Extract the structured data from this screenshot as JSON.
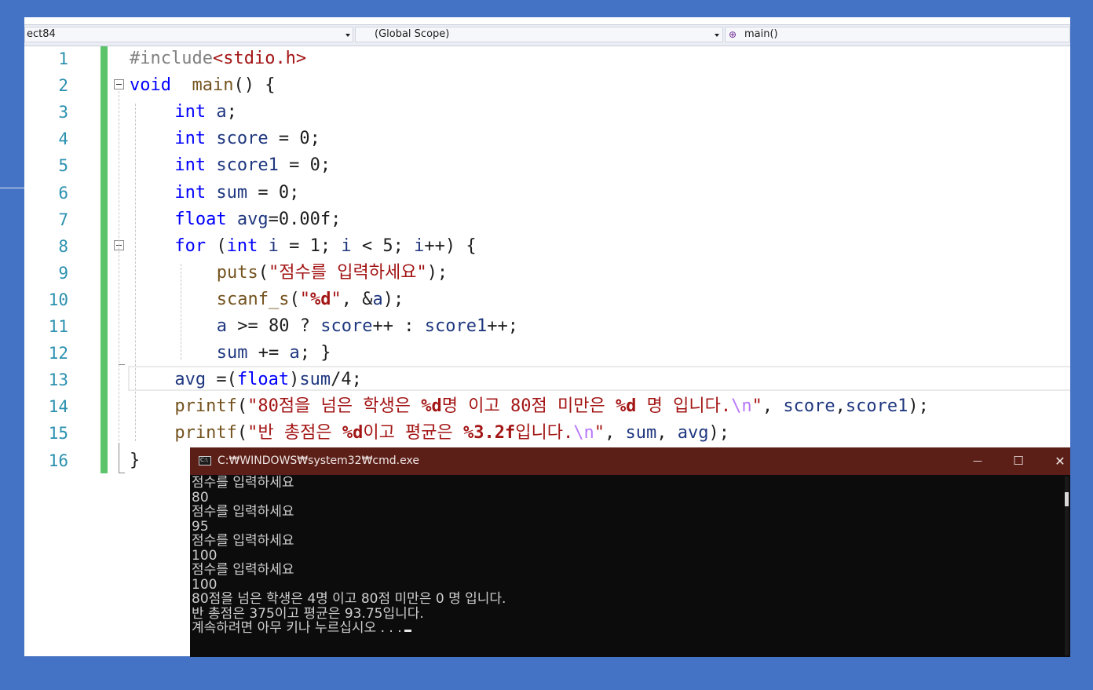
{
  "navbar": {
    "project": "ect84",
    "scope": "(Global Scope)",
    "function": "main()"
  },
  "line_numbers": [
    "1",
    "2",
    "3",
    "4",
    "5",
    "6",
    "7",
    "8",
    "9",
    "10",
    "11",
    "12",
    "13",
    "14",
    "15",
    "16"
  ],
  "code_lines": [
    {
      "indent": 0,
      "tokens": [
        [
          "pp",
          "#include"
        ],
        [
          "str",
          "<stdio.h>"
        ]
      ]
    },
    {
      "indent": 0,
      "tokens": [
        [
          "kw",
          "void"
        ],
        [
          "",
          "  "
        ],
        [
          "fn",
          "main"
        ],
        [
          "",
          "() {"
        ]
      ]
    },
    {
      "indent": 4,
      "tokens": [
        [
          "kw",
          "int"
        ],
        [
          "",
          " "
        ],
        [
          "var",
          "a"
        ],
        [
          "",
          ";"
        ]
      ]
    },
    {
      "indent": 4,
      "tokens": [
        [
          "kw",
          "int"
        ],
        [
          "",
          " "
        ],
        [
          "var",
          "score"
        ],
        [
          "",
          " = 0;"
        ]
      ]
    },
    {
      "indent": 4,
      "tokens": [
        [
          "kw",
          "int"
        ],
        [
          "",
          " "
        ],
        [
          "var",
          "score1"
        ],
        [
          "",
          " = 0;"
        ]
      ]
    },
    {
      "indent": 4,
      "tokens": [
        [
          "kw",
          "int"
        ],
        [
          "",
          " "
        ],
        [
          "var",
          "sum"
        ],
        [
          "",
          " = 0;"
        ]
      ]
    },
    {
      "indent": 4,
      "tokens": [
        [
          "kw",
          "float"
        ],
        [
          "",
          " "
        ],
        [
          "var",
          "avg"
        ],
        [
          "",
          "=0.00f;"
        ]
      ]
    },
    {
      "indent": 4,
      "tokens": [
        [
          "kw",
          "for"
        ],
        [
          "",
          " ("
        ],
        [
          "kw",
          "int"
        ],
        [
          "",
          " "
        ],
        [
          "var",
          "i"
        ],
        [
          "",
          " = 1; "
        ],
        [
          "var",
          "i"
        ],
        [
          "",
          " < 5; "
        ],
        [
          "var",
          "i"
        ],
        [
          "",
          "++) {"
        ]
      ]
    },
    {
      "indent": 8,
      "tokens": [
        [
          "fn",
          "puts"
        ],
        [
          "",
          "("
        ],
        [
          "str",
          "\"점수를 입력하세요\""
        ],
        [
          "",
          ");"
        ]
      ]
    },
    {
      "indent": 8,
      "tokens": [
        [
          "fn",
          "scanf_s"
        ],
        [
          "",
          "("
        ],
        [
          "str",
          "\""
        ],
        [
          "fmt",
          "%d"
        ],
        [
          "str",
          "\""
        ],
        [
          "",
          ", &"
        ],
        [
          "var",
          "a"
        ],
        [
          "",
          ");"
        ]
      ]
    },
    {
      "indent": 8,
      "tokens": [
        [
          "var",
          "a"
        ],
        [
          "",
          " >= 80 ? "
        ],
        [
          "var",
          "score"
        ],
        [
          "",
          "++ : "
        ],
        [
          "var",
          "score1"
        ],
        [
          "",
          "++;"
        ]
      ]
    },
    {
      "indent": 8,
      "tokens": [
        [
          "var",
          "sum"
        ],
        [
          "",
          " += "
        ],
        [
          "var",
          "a"
        ],
        [
          "",
          "; }"
        ]
      ]
    },
    {
      "indent": 4,
      "tokens": [
        [
          "var",
          "avg"
        ],
        [
          "",
          " =("
        ],
        [
          "kw",
          "float"
        ],
        [
          "",
          ")"
        ],
        [
          "var",
          "sum"
        ],
        [
          "",
          "/4;"
        ]
      ]
    },
    {
      "indent": 4,
      "tokens": [
        [
          "fn",
          "printf"
        ],
        [
          "",
          "("
        ],
        [
          "str",
          "\"80점을 넘은 학생은 "
        ],
        [
          "fmt",
          "%d"
        ],
        [
          "str",
          "명 이고 80점 미만은 "
        ],
        [
          "fmt",
          "%d"
        ],
        [
          "str",
          " 명 입니다."
        ],
        [
          "esc",
          "\\n"
        ],
        [
          "str",
          "\""
        ],
        [
          "",
          ", "
        ],
        [
          "var",
          "score"
        ],
        [
          "",
          ","
        ],
        [
          "var",
          "score1"
        ],
        [
          "",
          ");"
        ]
      ]
    },
    {
      "indent": 4,
      "tokens": [
        [
          "fn",
          "printf"
        ],
        [
          "",
          "("
        ],
        [
          "str",
          "\"반 총점은 "
        ],
        [
          "fmt",
          "%d"
        ],
        [
          "str",
          "이고 평균은 "
        ],
        [
          "fmt",
          "%3.2f"
        ],
        [
          "str",
          "입니다."
        ],
        [
          "esc",
          "\\n"
        ],
        [
          "str",
          "\""
        ],
        [
          "",
          ", "
        ],
        [
          "var",
          "sum"
        ],
        [
          "",
          ", "
        ],
        [
          "var",
          "avg"
        ],
        [
          "",
          ");"
        ]
      ]
    },
    {
      "indent": 0,
      "tokens": [
        [
          "",
          "}"
        ]
      ]
    }
  ],
  "cmd": {
    "title": "C:₩WINDOWS₩system32₩cmd.exe",
    "minimize": "—",
    "maximize": "☐",
    "close": "✕",
    "output": [
      "점수를 입력하세요",
      "80",
      "점수를 입력하세요",
      "95",
      "점수를 입력하세요",
      "100",
      "점수를 입력하세요",
      "100",
      "80점을 넘은 학생은 4명 이고 80점 미만은 0 명 입니다.",
      "반 총점은 375이고 평균은 93.75입니다.",
      "계속하려면 아무 키나 누르십시오 . . ."
    ]
  },
  "colors": {
    "background": "#4472c4",
    "keyword": "#0000ff",
    "string": "#a31515",
    "change_bar": "#5ec46b",
    "cmd_title": "#5b1f18"
  }
}
